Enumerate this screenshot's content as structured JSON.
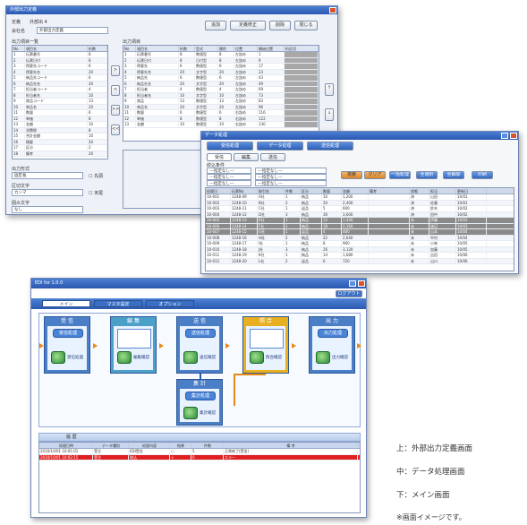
{
  "top_window": {
    "title": "外部出力定義",
    "code_label": "定義",
    "code_value": "外部出 4",
    "company_label": "会社名",
    "company_value": "外部出力定義",
    "buttons": [
      "追加",
      "定義修正",
      "削除",
      "閉じる"
    ],
    "left_list_label": "出力項目一覧",
    "left_cols": [
      "No",
      "項目名",
      "桁数"
    ],
    "left_rows": [
      [
        "1",
        "伝票番号",
        "8"
      ],
      [
        "2",
        "伝票日付",
        "8"
      ],
      [
        "3",
        "得意先コード",
        "6"
      ],
      [
        "4",
        "得意先名",
        "20"
      ],
      [
        "5",
        "納品先コード",
        "6"
      ],
      [
        "6",
        "納品先名",
        "20"
      ],
      [
        "7",
        "担当者コード",
        "4"
      ],
      [
        "8",
        "担当者名",
        "10"
      ],
      [
        "9",
        "商品コード",
        "13"
      ],
      [
        "10",
        "商品名",
        "20"
      ],
      [
        "11",
        "数量",
        "6"
      ],
      [
        "12",
        "単価",
        "8"
      ],
      [
        "13",
        "金額",
        "10"
      ],
      [
        "14",
        "消費税",
        "8"
      ],
      [
        "15",
        "合計金額",
        "10"
      ],
      [
        "16",
        "摘要",
        "20"
      ],
      [
        "17",
        "区分",
        "2"
      ],
      [
        "18",
        "備考",
        "20"
      ]
    ],
    "move_buttons": [
      ">",
      "<",
      ">>",
      "<<"
    ],
    "right_list_label": "出力項目",
    "right_cols": [
      "No",
      "項目名",
      "桁数",
      "型式",
      "属性",
      "位置",
      "開始位置",
      "桁区切"
    ],
    "right_rows": [
      [
        "1",
        "伝票番号",
        "8",
        "数値型",
        "8",
        "左詰め",
        "1",
        ""
      ],
      [
        "2",
        "伝票日付",
        "8",
        "日付型",
        "8",
        "左詰め",
        "9",
        ""
      ],
      [
        "3",
        "得意先",
        "6",
        "数値型",
        "6",
        "左詰め",
        "17",
        ""
      ],
      [
        "4",
        "得意先名",
        "20",
        "文字型",
        "20",
        "左詰め",
        "23",
        ""
      ],
      [
        "5",
        "納品先",
        "6",
        "数値型",
        "6",
        "左詰め",
        "43",
        ""
      ],
      [
        "6",
        "納品先名",
        "20",
        "文字型",
        "20",
        "左詰め",
        "49",
        ""
      ],
      [
        "7",
        "担当者",
        "4",
        "数値型",
        "4",
        "左詰め",
        "69",
        ""
      ],
      [
        "8",
        "担当者名",
        "10",
        "文字型",
        "10",
        "左詰め",
        "73",
        ""
      ],
      [
        "9",
        "商品",
        "13",
        "数値型",
        "13",
        "左詰め",
        "83",
        ""
      ],
      [
        "10",
        "商品名",
        "20",
        "文字型",
        "20",
        "左詰め",
        "96",
        ""
      ],
      [
        "11",
        "数量",
        "6",
        "数値型",
        "6",
        "右詰め",
        "116",
        ""
      ],
      [
        "12",
        "単価",
        "8",
        "数値型",
        "8",
        "右詰め",
        "122",
        ""
      ],
      [
        "13",
        "金額",
        "10",
        "数値型",
        "10",
        "右詰め",
        "130",
        ""
      ]
    ],
    "opt_label1": "出力形式",
    "opt_select1": "固定長",
    "opt_label2": "区切文字",
    "opt_select2": "カンマ",
    "opt_label3": "囲み文字",
    "opt_select3": "なし",
    "checkbox_labels": [
      "先頭",
      "末尾"
    ]
  },
  "mid_window": {
    "title": "データ処理",
    "toolbar": [
      "受信処理",
      "データ処理",
      "送信処理"
    ],
    "tabs": [
      "受信",
      "編集",
      "送信"
    ],
    "filter_label": "絞込条件",
    "filters": [
      "---指定なし---",
      "---指定なし---",
      "---指定なし---"
    ],
    "action_buttons": [
      "検索",
      "クリア",
      "一括処理",
      "全選択",
      "全解除",
      "印刷"
    ],
    "cols": [
      "処理日",
      "伝票No",
      "取引先",
      "件数",
      "区分",
      "数量",
      "金額",
      "備考",
      "状態",
      "担当",
      "更新日"
    ],
    "rows": [
      [
        "10-001",
        "1248-09",
        "A社",
        "1",
        "納品",
        "10",
        "1,200",
        "",
        "済",
        "山田",
        "10/01"
      ],
      [
        "10-002",
        "1248-10",
        "B社",
        "2",
        "納品",
        "20",
        "2,400",
        "",
        "済",
        "佐藤",
        "10/01"
      ],
      [
        "10-003",
        "1248-11",
        "C社",
        "1",
        "返品",
        "5",
        "600",
        "",
        "済",
        "鈴木",
        "10/02"
      ],
      [
        "10-004",
        "1248-12",
        "D社",
        "3",
        "納品",
        "30",
        "3,600",
        "",
        "済",
        "田中",
        "10/02"
      ],
      [
        "10-005",
        "1248-13",
        "E社",
        "1",
        "納品",
        "12",
        "1,440",
        "",
        "未",
        "伊藤",
        "10/03"
      ],
      [
        "10-006",
        "1248-14",
        "F社",
        "2",
        "納品",
        "18",
        "2,160",
        "",
        "未",
        "渡辺",
        "10/03"
      ],
      [
        "10-007",
        "1248-15",
        "G社",
        "1",
        "返品",
        "4",
        "480",
        "",
        "未",
        "山本",
        "10/04"
      ],
      [
        "10-008",
        "1248-16",
        "H社",
        "2",
        "納品",
        "22",
        "2,640",
        "",
        "未",
        "中村",
        "10/04"
      ],
      [
        "10-009",
        "1248-17",
        "I社",
        "1",
        "納品",
        "8",
        "960",
        "",
        "未",
        "小林",
        "10/05"
      ],
      [
        "10-010",
        "1248-18",
        "J社",
        "3",
        "納品",
        "26",
        "3,120",
        "",
        "未",
        "加藤",
        "10/05"
      ],
      [
        "10-011",
        "1248-19",
        "K社",
        "1",
        "納品",
        "14",
        "1,680",
        "",
        "未",
        "吉田",
        "10/06"
      ],
      [
        "10-012",
        "1248-20",
        "L社",
        "2",
        "返品",
        "6",
        "720",
        "",
        "未",
        "山口",
        "10/06"
      ]
    ]
  },
  "main_window": {
    "title": "EDI for 1.0.0",
    "header_button": "ログアウト",
    "tabs": [
      "メイン",
      "マスタ設定",
      "オプション"
    ],
    "stages": [
      {
        "head": "受 信",
        "bubble": "受信処理",
        "icon": "data-receive-icon",
        "label": "受信処理"
      },
      {
        "head": "編 集",
        "bubble": "",
        "icon": "data-edit-icon",
        "label": "編集確認"
      },
      {
        "head": "送 信",
        "bubble": "送信処理",
        "icon": "data-send-icon",
        "label": "送信確認"
      },
      {
        "head": "照 合",
        "bubble": "",
        "icon": "data-check-icon",
        "label": "照合確認"
      },
      {
        "head": "出 力",
        "bubble": "出力処理",
        "icon": "data-output-icon",
        "label": "出力確認"
      }
    ],
    "lower_stage": {
      "head": "集 計",
      "bubble": "集計処理",
      "label": "集計確認"
    },
    "log_title": "履 歴",
    "log_cols": [
      "処理日時",
      "データ種別",
      "処理内容",
      "結果",
      "件数",
      "備 考"
    ],
    "log_rows": [
      [
        "2010/10/01 10:01:01",
        "受注",
        "EDI受信",
        "○",
        "5",
        "正常終了(受信)"
      ],
      [
        "2010/10/01 10:02:15",
        "受注",
        "取込",
        "×",
        "0",
        "エラー"
      ]
    ]
  },
  "captions": [
    "上：外部出力定義画面",
    "中：データ処理画面",
    "下：メイン画面",
    "※画面イメージです。"
  ]
}
